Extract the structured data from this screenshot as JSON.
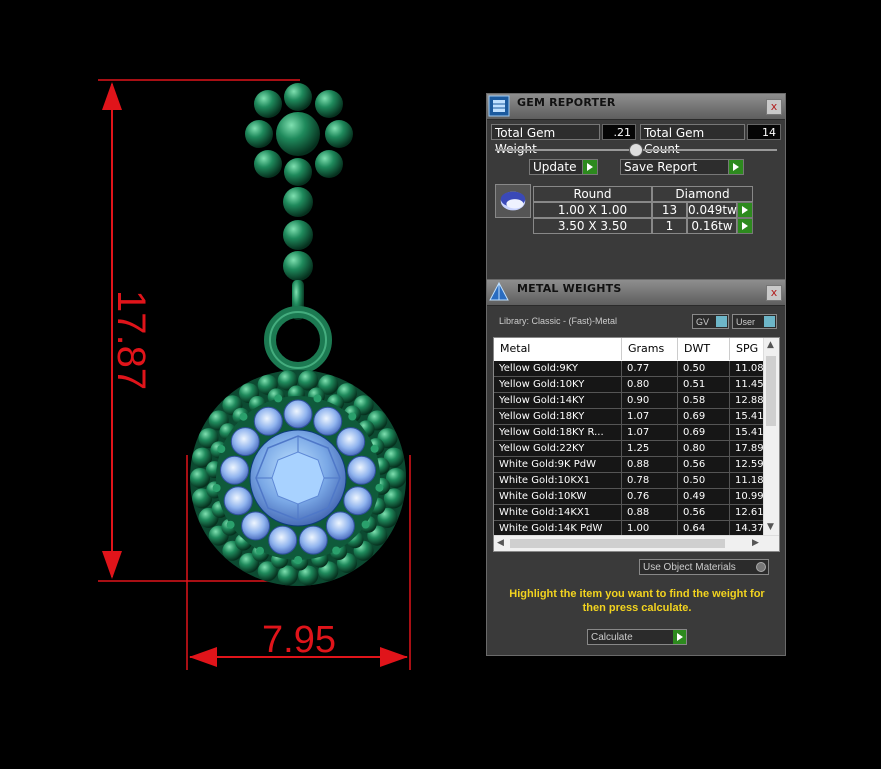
{
  "dimensions": {
    "height": "17.87",
    "width": "7.95",
    "color": "#e0141a"
  },
  "gem_reporter": {
    "title": "GEM REPORTER",
    "close_label": "x",
    "total_weight_label": "Total Gem Weight",
    "total_weight_value": ".21",
    "total_count_label": "Total Gem Count",
    "total_count_value": "14",
    "update_label": "Update",
    "save_report_label": "Save Report",
    "table": {
      "header_shape": "Round",
      "header_material": "Diamond",
      "rows": [
        {
          "size": "1.00 X 1.00",
          "count": "13",
          "weight": "0.049tw"
        },
        {
          "size": "3.50 X 3.50",
          "count": "1",
          "weight": "0.16tw"
        }
      ]
    }
  },
  "metal_weights": {
    "title": "METAL WEIGHTS",
    "close_label": "x",
    "library_label": "Library: Classic - (Fast)-Metal",
    "gv_label": "GV",
    "user_label": "User",
    "columns": [
      "Metal",
      "Grams",
      "DWT",
      "SPG"
    ],
    "rows": [
      {
        "metal": "Yellow Gold:9KY",
        "grams": "0.77",
        "dwt": "0.50",
        "spg": "11.08"
      },
      {
        "metal": "Yellow Gold:10KY",
        "grams": "0.80",
        "dwt": "0.51",
        "spg": "11.45"
      },
      {
        "metal": "Yellow Gold:14KY",
        "grams": "0.90",
        "dwt": "0.58",
        "spg": "12.88"
      },
      {
        "metal": "Yellow Gold:18KY",
        "grams": "1.07",
        "dwt": "0.69",
        "spg": "15.41"
      },
      {
        "metal": "Yellow Gold:18KY R...",
        "grams": "1.07",
        "dwt": "0.69",
        "spg": "15.41"
      },
      {
        "metal": "Yellow Gold:22KY",
        "grams": "1.25",
        "dwt": "0.80",
        "spg": "17.89"
      },
      {
        "metal": "White Gold:9K PdW",
        "grams": "0.88",
        "dwt": "0.56",
        "spg": "12.59"
      },
      {
        "metal": "White Gold:10KX1",
        "grams": "0.78",
        "dwt": "0.50",
        "spg": "11.18"
      },
      {
        "metal": "White Gold:10KW",
        "grams": "0.76",
        "dwt": "0.49",
        "spg": "10.99"
      },
      {
        "metal": "White Gold:14KX1",
        "grams": "0.88",
        "dwt": "0.56",
        "spg": "12.61"
      },
      {
        "metal": "White Gold:14K PdW",
        "grams": "1.00",
        "dwt": "0.64",
        "spg": "14.37"
      }
    ],
    "use_object_materials_label": "Use Object Materials",
    "hint": "Highlight the item you want to find the weight for then press calculate.",
    "calculate_label": "Calculate"
  },
  "colors": {
    "background": "#000000",
    "dimension_red": "#e0141a",
    "metal_green": "#1c7a52",
    "gem_blue": "#7aa8e6",
    "hint_yellow": "#f2d31f",
    "go_green": "#2d8a1e"
  }
}
